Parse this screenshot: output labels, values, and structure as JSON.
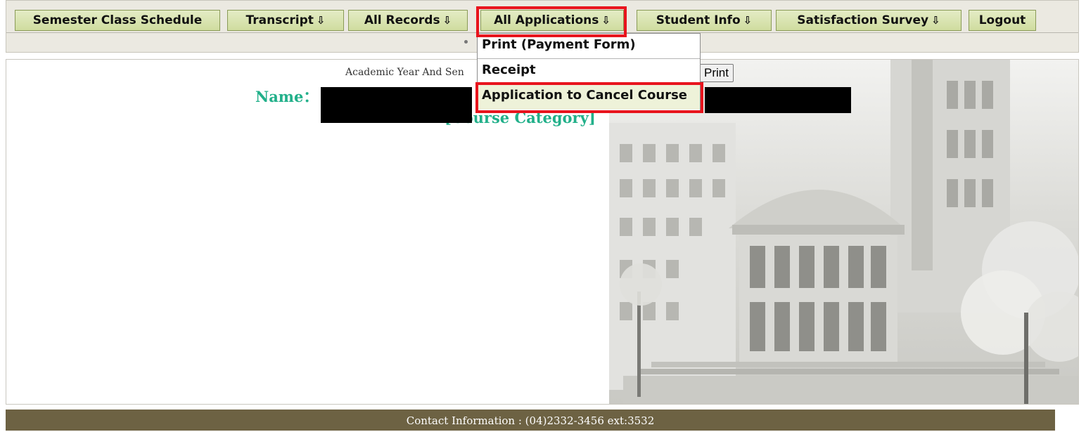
{
  "nav": {
    "items": [
      {
        "label": "Semester Class Schedule",
        "has_dropdown": false
      },
      {
        "label": "Transcript",
        "has_dropdown": true
      },
      {
        "label": "All Records",
        "has_dropdown": true
      },
      {
        "label": "All Applications",
        "has_dropdown": true
      },
      {
        "label": "Student Info",
        "has_dropdown": true
      },
      {
        "label": "Satisfaction Survey",
        "has_dropdown": true
      },
      {
        "label": "Logout",
        "has_dropdown": false
      }
    ],
    "dropdown_arrow_icon": "down-arrow-outline-icon",
    "dropdown": {
      "items": [
        {
          "label": "Print (Payment Form)"
        },
        {
          "label": "Receipt"
        },
        {
          "label": "Application to Cancel Course"
        }
      ]
    }
  },
  "main": {
    "year_label": "Academic Year And Sen",
    "print_label": "Print",
    "name_label": "Name：",
    "course_category": "[Course Category]"
  },
  "footer": {
    "contact": "Contact Information : (04)2332-3456 ext:3532"
  },
  "colors": {
    "highlight": "#e8141d",
    "name_text": "#22b08a",
    "footer_bg": "#6d6243",
    "nav_button": "#d9e3b0"
  }
}
